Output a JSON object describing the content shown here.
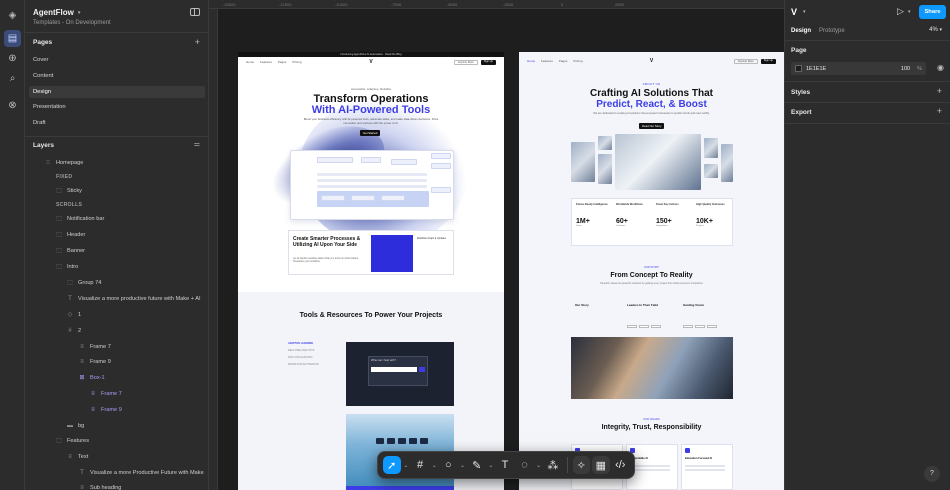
{
  "file": {
    "name": "AgentFlow",
    "subtitle": "Templates - On Development"
  },
  "pages": {
    "heading": "Pages",
    "items": [
      "Cover",
      "Content",
      "Design",
      "Presentation",
      "Draft"
    ],
    "active": "Design"
  },
  "layers": {
    "heading": "Layers",
    "items": [
      {
        "label": "Homepage",
        "icon": "frame-grid-icon"
      },
      {
        "label": "FIXED",
        "icon": ""
      },
      {
        "label": "Sticky",
        "icon": "frame-icon"
      },
      {
        "label": "SCROLLS",
        "icon": ""
      },
      {
        "label": "Notification bar",
        "icon": "frame-icon"
      },
      {
        "label": "Header",
        "icon": "frame-icon"
      },
      {
        "label": "Banner",
        "icon": "frame-icon"
      },
      {
        "label": "Intro",
        "icon": "frame-icon"
      },
      {
        "label": "Group 74",
        "icon": "group-icon"
      },
      {
        "label": "Visualize a more productive future with Make + AI",
        "icon": "text-icon"
      },
      {
        "label": "1",
        "icon": "component-icon"
      },
      {
        "label": "2",
        "icon": "frame-icon"
      },
      {
        "label": "Frame 7",
        "icon": "autolayout-icon"
      },
      {
        "label": "Frame 9",
        "icon": "autolayout-icon"
      },
      {
        "label": "Box-1",
        "icon": "instance-icon"
      },
      {
        "label": "Frame 7",
        "icon": "autolayout-icon"
      },
      {
        "label": "Frame 9",
        "icon": "autolayout-icon"
      },
      {
        "label": "bg",
        "icon": "rect-icon"
      },
      {
        "label": "Features",
        "icon": "frame-icon"
      },
      {
        "label": "Text",
        "icon": "autolayout-icon"
      },
      {
        "label": "Visualize a more Productive Future with Make",
        "icon": "text-icon"
      },
      {
        "label": "Sub heading",
        "icon": "autolayout-icon"
      }
    ]
  },
  "rulers": [
    "-15000",
    "-12500",
    "-10000",
    "-7500",
    "-5000",
    "-2500",
    "0",
    "2500"
  ],
  "frame1": {
    "topbar": "Introducing AgentFlow AI Automation · Read the Blog",
    "nav_links": [
      "Home",
      "Features",
      "Pages",
      "Pricing"
    ],
    "nav_btn_explore": "Explore More",
    "nav_btn_signup": "Sign Up",
    "hero_eyebrow": "Accessible, Adaptive, Reliable",
    "hero_title_1": "Transform Operations",
    "hero_title_2": "With AI-Powered Tools",
    "hero_desc": "Boost your business efficiency with AI-powered tools, automate tasks, and make data-driven decisions. Drive innovation and success with the power of AI.",
    "hero_cta": "Get Started",
    "card_title": "Create Smarter Processes & Utilizing AI Upon Your Side",
    "card_desc": "Let AI handle repetitive tasks while you focus on what matters. Streamline your workflow.",
    "card_side": "Workflow Graph & Updates",
    "section_title": "Tools & Resources To Power Your Projects",
    "tabs": [
      "ADAPTIVE LEARNING",
      "REAL-TIME ANALYTICS",
      "DATA VISUALIZATION",
      "WORKFLOW AUTOMATION"
    ],
    "panel_text": "What can I help with?"
  },
  "frame2": {
    "nav_links": [
      "Home",
      "Features",
      "Pages",
      "Pricing"
    ],
    "eyebrow": "ABOUT US",
    "title_1": "Crafting AI Solutions That",
    "title_2": "Predict, React, & Boost",
    "sub": "We are dedicated to creating AI solutions that empower businesses to predict trends and react swiftly.",
    "cta": "Read Our Story",
    "stats_headers": [
      "Future-Ready Intelligence",
      "Worldwide Workflows",
      "Know Key Actions",
      "High Quality Outcomes"
    ],
    "stats": [
      {
        "num": "1M+",
        "label": "Users"
      },
      {
        "num": "60+",
        "label": "Countries"
      },
      {
        "num": "150+",
        "label": "Integrations"
      },
      {
        "num": "10K+",
        "label": "Projects"
      }
    ],
    "concept_eyebrow": "OUR STORY",
    "concept_title": "From Concept To Reality",
    "concept_sub": "Transform ideas into powerful solutions by guiding every project from initial concept to completion.",
    "story_cols": [
      "Our Story",
      "Leaders In Their Field",
      "Guiding Vision"
    ],
    "trust_eyebrow": "OUR VALUES",
    "trust_title": "Integrity, Trust, Responsibility",
    "trust_cards": [
      "",
      "Dependable AI",
      "Education Focused AI"
    ]
  },
  "right": {
    "tabs": [
      "Design",
      "Prototype"
    ],
    "active_tab": "Design",
    "zoom": "4%",
    "page_heading": "Page",
    "bg_color": "1E1E1E",
    "bg_opacity": "100",
    "bg_unit": "%",
    "styles_heading": "Styles",
    "export_heading": "Export",
    "share_label": "Share"
  },
  "colors": {
    "accent": "#0d99ff",
    "brand": "#3d3de8",
    "bg": "#1e1e1e",
    "panel": "#2c2c2c"
  }
}
